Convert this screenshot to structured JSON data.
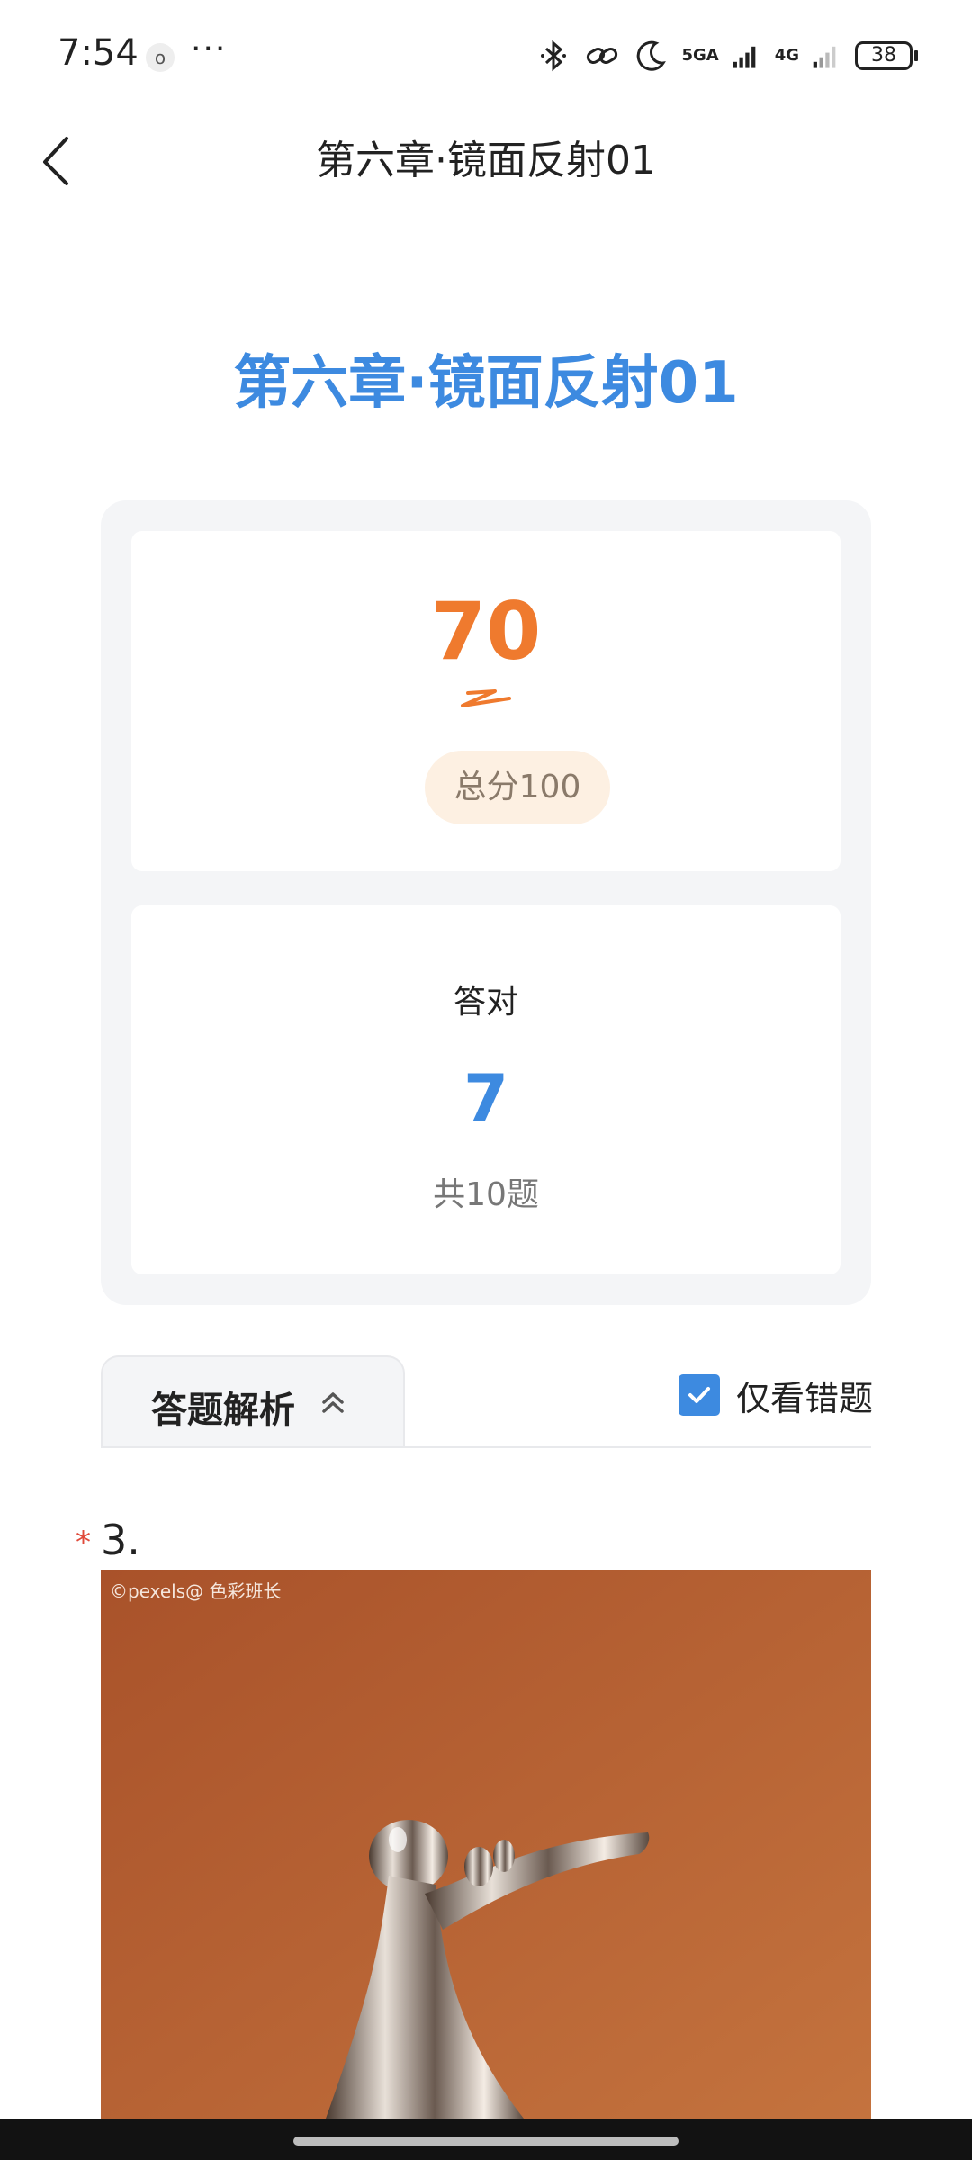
{
  "status_bar": {
    "time": "7:54",
    "app_dot": "o",
    "more": "···",
    "signal_1_label": "5GA",
    "signal_2_label": "4G",
    "battery": "38"
  },
  "nav": {
    "title": "第六章·镜面反射01"
  },
  "headline": "第六章·镜面反射01",
  "score": {
    "value": "70",
    "total": "总分100"
  },
  "correct": {
    "label": "答对",
    "value": "7",
    "total": "共10题"
  },
  "analysis": {
    "tab_label": "答题解析",
    "wrong_only_label": "仅看错题",
    "wrong_only_checked": true
  },
  "question": {
    "number": "3.",
    "required_mark": "*",
    "image_watermark": "©pexels@ 色彩班长"
  },
  "colors": {
    "accent_blue": "#3d8ae0",
    "score_orange": "#ef7a2e",
    "required_red": "#e04a3a"
  }
}
